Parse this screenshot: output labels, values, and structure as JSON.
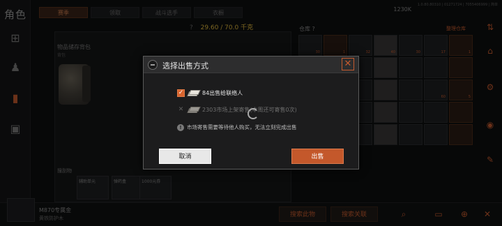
{
  "rail": {
    "title": "角色"
  },
  "tabs": [
    "赛季",
    "领取",
    "战斗选手",
    "衣橱"
  ],
  "header": {
    "currency": "1230K",
    "sysinfo": "1.0.80.80310 | 01271724 | 7055406999 | 简单",
    "capacity_help": "?",
    "capacity": "29.60 / 70.0 千克"
  },
  "stash": {
    "header": "物品储存背包",
    "sub": "背包",
    "loot_label": "搜刮物",
    "loot_slots": [
      "辅助单元",
      "弹药盒",
      "1000元券"
    ]
  },
  "warehouse": {
    "title": "仓库",
    "help": "?",
    "sort": "整理仓库"
  },
  "grid_quantities": [
    "30",
    "1",
    "32",
    "40",
    "30",
    "17",
    "1",
    "",
    "",
    "",
    "",
    "",
    "",
    "",
    "",
    "",
    "",
    "",
    "",
    "60",
    "5",
    "",
    "",
    "",
    "",
    "",
    "",
    "",
    "40",
    "1",
    "",
    "",
    "",
    "",
    ""
  ],
  "bottom": {
    "weapon_name": "M870专属金",
    "weapon_sub": "黄铁防护木",
    "search_this": "搜索此物",
    "search_related": "搜索关联"
  },
  "dialog": {
    "title": "选择出售方式",
    "option_a_text": "84出售给联络人",
    "option_b_text": "2303市场上架寄售(本周还可寄售0次)",
    "note": "市场寄售需要等待他人购买，无法立刻完成出售",
    "cancel_label": "取消",
    "sell_label": "出售"
  },
  "icons": {
    "close": "close-icon",
    "check": "checkbox-checked-icon",
    "cash": "cash-stack-icon",
    "warning": "warning-icon",
    "spinner": "loading-spinner-icon"
  },
  "colors": {
    "accent": "#c4582b",
    "capacity": "#e0b93d",
    "panel": "#1c1c1d"
  }
}
